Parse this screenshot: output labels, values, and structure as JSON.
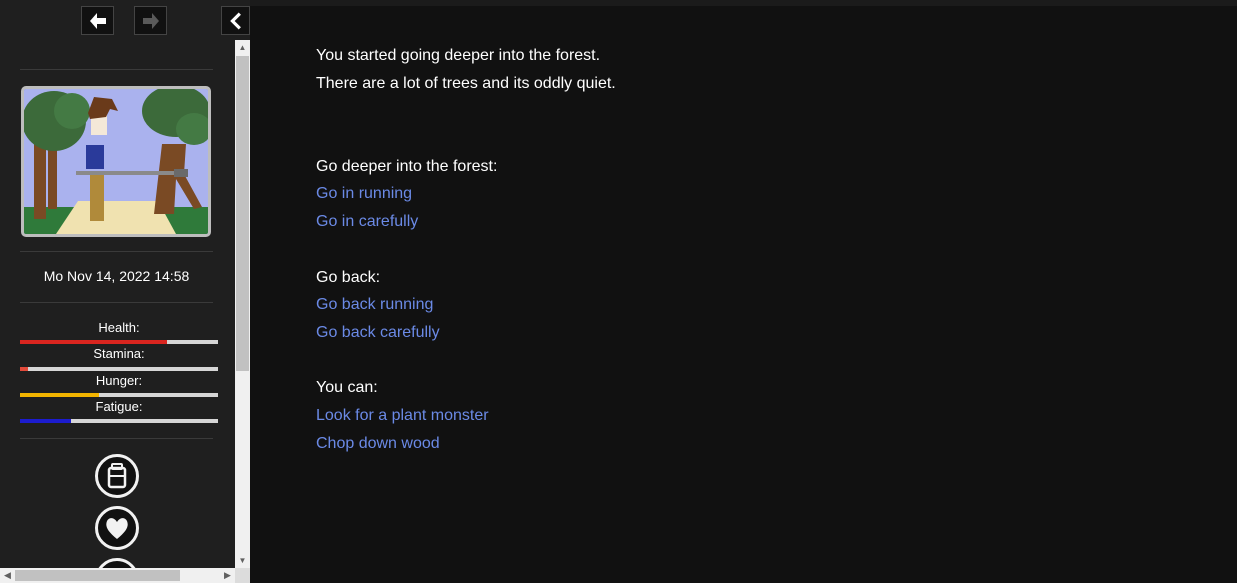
{
  "sidebar": {
    "datetime": "Mo Nov 14, 2022 14:58",
    "stats": [
      {
        "label": "Health:",
        "value": 0.74,
        "color": "#d9251f"
      },
      {
        "label": "Stamina:",
        "value": 0.04,
        "color": "#e24a3a"
      },
      {
        "label": "Hunger:",
        "value": 0.4,
        "color": "#f2b400"
      },
      {
        "label": "Fatigue:",
        "value": 0.26,
        "color": "#1c1ccf"
      }
    ]
  },
  "passage": {
    "intro_line_1": "You started going deeper into the forest.",
    "intro_line_2": "There are a lot of trees and its oddly quiet.",
    "section_1_heading": "Go deeper into the forest:",
    "section_1_links": [
      "Go in running",
      "Go in carefully"
    ],
    "section_2_heading": "Go back:",
    "section_2_links": [
      "Go back running",
      "Go back carefully"
    ],
    "section_3_heading": "You can:",
    "section_3_links": [
      "Look for a plant monster",
      "Chop down wood"
    ]
  }
}
